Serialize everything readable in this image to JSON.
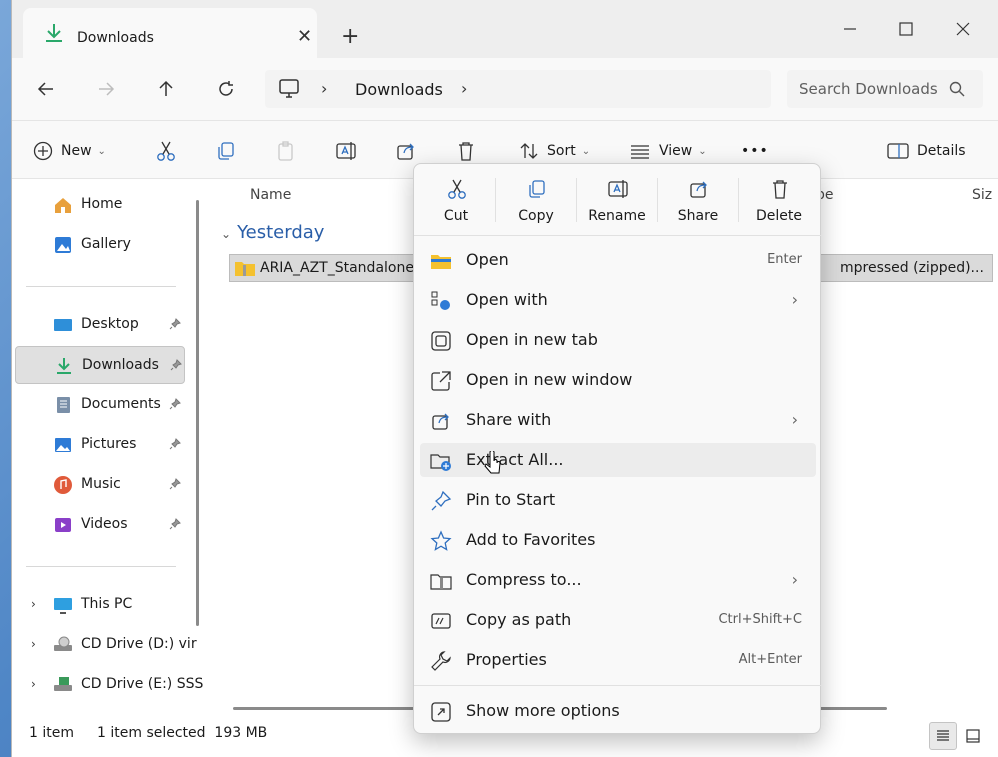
{
  "tab": {
    "title": "Downloads",
    "close": "✕",
    "new_tab": "+"
  },
  "window_controls": {
    "minimize": "—",
    "maximize": "☐",
    "close": "✕"
  },
  "nav": {
    "back": "←",
    "forward": "→",
    "up": "↑",
    "refresh": "↻"
  },
  "address": {
    "separator": "›",
    "crumb": "Downloads",
    "separator_end": "›"
  },
  "search": {
    "placeholder": "Search Downloads"
  },
  "toolbar": {
    "new_label": "New",
    "sort_label": "Sort",
    "view_label": "View",
    "more_label": "•••",
    "details_label": "Details",
    "chevron": "⌄"
  },
  "sidebar": {
    "home": "Home",
    "gallery": "Gallery",
    "pinned": [
      {
        "label": "Desktop"
      },
      {
        "label": "Downloads"
      },
      {
        "label": "Documents"
      },
      {
        "label": "Pictures"
      },
      {
        "label": "Music"
      },
      {
        "label": "Videos"
      }
    ],
    "drives": [
      {
        "label": "This PC"
      },
      {
        "label": "CD Drive (D:) vir"
      },
      {
        "label": "CD Drive (E:) SSS"
      }
    ],
    "expand_glyph": "›"
  },
  "columns": {
    "name": "Name",
    "type": "pe",
    "size": "Siz"
  },
  "group": {
    "chevron": "⌄",
    "label": "Yesterday"
  },
  "file": {
    "name": "ARIA_AZT_Standalone_",
    "type": "mpressed (zipped)..."
  },
  "status": {
    "count": "1 item",
    "selected": "1 item selected  193 MB"
  },
  "context_menu": {
    "quick": [
      {
        "label": "Cut",
        "icon": "scissors-icon"
      },
      {
        "label": "Copy",
        "icon": "copy-icon"
      },
      {
        "label": "Rename",
        "icon": "rename-icon"
      },
      {
        "label": "Share",
        "icon": "share-icon"
      },
      {
        "label": "Delete",
        "icon": "trash-icon"
      }
    ],
    "items": [
      {
        "label": "Open",
        "shortcut": "Enter",
        "arrow": ""
      },
      {
        "label": "Open with",
        "shortcut": "",
        "arrow": "›"
      },
      {
        "label": "Open in new tab",
        "shortcut": "",
        "arrow": ""
      },
      {
        "label": "Open in new window",
        "shortcut": "",
        "arrow": ""
      },
      {
        "label": "Share with",
        "shortcut": "",
        "arrow": "›"
      },
      {
        "label": "Extract All...",
        "shortcut": "",
        "arrow": ""
      },
      {
        "label": "Pin to Start",
        "shortcut": "",
        "arrow": ""
      },
      {
        "label": "Add to Favorites",
        "shortcut": "",
        "arrow": ""
      },
      {
        "label": "Compress to...",
        "shortcut": "",
        "arrow": "›"
      },
      {
        "label": "Copy as path",
        "shortcut": "Ctrl+Shift+C",
        "arrow": ""
      },
      {
        "label": "Properties",
        "shortcut": "Alt+Enter",
        "arrow": ""
      }
    ],
    "more_options": "Show more options"
  },
  "colors": {
    "accent": "#0067c0",
    "folder": "#f4c12f",
    "download_green": "#2aa86a",
    "group_blue": "#2a5ea8"
  }
}
